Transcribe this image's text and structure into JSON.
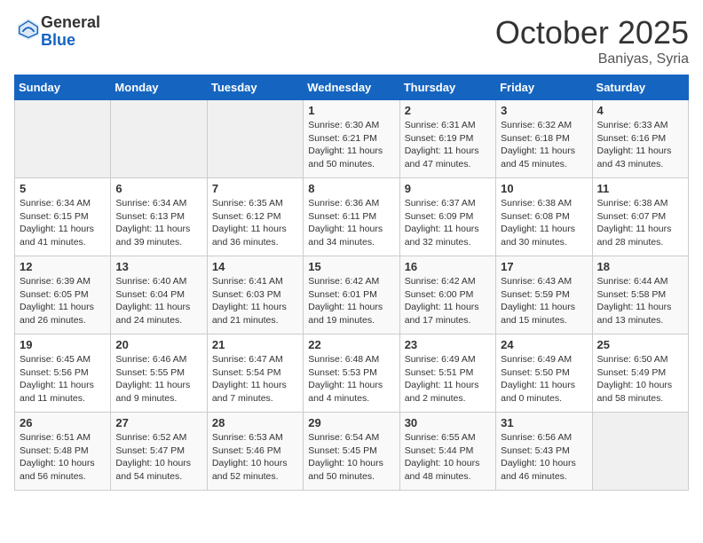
{
  "header": {
    "logo_line1": "General",
    "logo_line2": "Blue",
    "month": "October 2025",
    "location": "Baniyas, Syria"
  },
  "weekdays": [
    "Sunday",
    "Monday",
    "Tuesday",
    "Wednesday",
    "Thursday",
    "Friday",
    "Saturday"
  ],
  "weeks": [
    [
      {
        "day": "",
        "info": ""
      },
      {
        "day": "",
        "info": ""
      },
      {
        "day": "",
        "info": ""
      },
      {
        "day": "1",
        "info": "Sunrise: 6:30 AM\nSunset: 6:21 PM\nDaylight: 11 hours\nand 50 minutes."
      },
      {
        "day": "2",
        "info": "Sunrise: 6:31 AM\nSunset: 6:19 PM\nDaylight: 11 hours\nand 47 minutes."
      },
      {
        "day": "3",
        "info": "Sunrise: 6:32 AM\nSunset: 6:18 PM\nDaylight: 11 hours\nand 45 minutes."
      },
      {
        "day": "4",
        "info": "Sunrise: 6:33 AM\nSunset: 6:16 PM\nDaylight: 11 hours\nand 43 minutes."
      }
    ],
    [
      {
        "day": "5",
        "info": "Sunrise: 6:34 AM\nSunset: 6:15 PM\nDaylight: 11 hours\nand 41 minutes."
      },
      {
        "day": "6",
        "info": "Sunrise: 6:34 AM\nSunset: 6:13 PM\nDaylight: 11 hours\nand 39 minutes."
      },
      {
        "day": "7",
        "info": "Sunrise: 6:35 AM\nSunset: 6:12 PM\nDaylight: 11 hours\nand 36 minutes."
      },
      {
        "day": "8",
        "info": "Sunrise: 6:36 AM\nSunset: 6:11 PM\nDaylight: 11 hours\nand 34 minutes."
      },
      {
        "day": "9",
        "info": "Sunrise: 6:37 AM\nSunset: 6:09 PM\nDaylight: 11 hours\nand 32 minutes."
      },
      {
        "day": "10",
        "info": "Sunrise: 6:38 AM\nSunset: 6:08 PM\nDaylight: 11 hours\nand 30 minutes."
      },
      {
        "day": "11",
        "info": "Sunrise: 6:38 AM\nSunset: 6:07 PM\nDaylight: 11 hours\nand 28 minutes."
      }
    ],
    [
      {
        "day": "12",
        "info": "Sunrise: 6:39 AM\nSunset: 6:05 PM\nDaylight: 11 hours\nand 26 minutes."
      },
      {
        "day": "13",
        "info": "Sunrise: 6:40 AM\nSunset: 6:04 PM\nDaylight: 11 hours\nand 24 minutes."
      },
      {
        "day": "14",
        "info": "Sunrise: 6:41 AM\nSunset: 6:03 PM\nDaylight: 11 hours\nand 21 minutes."
      },
      {
        "day": "15",
        "info": "Sunrise: 6:42 AM\nSunset: 6:01 PM\nDaylight: 11 hours\nand 19 minutes."
      },
      {
        "day": "16",
        "info": "Sunrise: 6:42 AM\nSunset: 6:00 PM\nDaylight: 11 hours\nand 17 minutes."
      },
      {
        "day": "17",
        "info": "Sunrise: 6:43 AM\nSunset: 5:59 PM\nDaylight: 11 hours\nand 15 minutes."
      },
      {
        "day": "18",
        "info": "Sunrise: 6:44 AM\nSunset: 5:58 PM\nDaylight: 11 hours\nand 13 minutes."
      }
    ],
    [
      {
        "day": "19",
        "info": "Sunrise: 6:45 AM\nSunset: 5:56 PM\nDaylight: 11 hours\nand 11 minutes."
      },
      {
        "day": "20",
        "info": "Sunrise: 6:46 AM\nSunset: 5:55 PM\nDaylight: 11 hours\nand 9 minutes."
      },
      {
        "day": "21",
        "info": "Sunrise: 6:47 AM\nSunset: 5:54 PM\nDaylight: 11 hours\nand 7 minutes."
      },
      {
        "day": "22",
        "info": "Sunrise: 6:48 AM\nSunset: 5:53 PM\nDaylight: 11 hours\nand 4 minutes."
      },
      {
        "day": "23",
        "info": "Sunrise: 6:49 AM\nSunset: 5:51 PM\nDaylight: 11 hours\nand 2 minutes."
      },
      {
        "day": "24",
        "info": "Sunrise: 6:49 AM\nSunset: 5:50 PM\nDaylight: 11 hours\nand 0 minutes."
      },
      {
        "day": "25",
        "info": "Sunrise: 6:50 AM\nSunset: 5:49 PM\nDaylight: 10 hours\nand 58 minutes."
      }
    ],
    [
      {
        "day": "26",
        "info": "Sunrise: 6:51 AM\nSunset: 5:48 PM\nDaylight: 10 hours\nand 56 minutes."
      },
      {
        "day": "27",
        "info": "Sunrise: 6:52 AM\nSunset: 5:47 PM\nDaylight: 10 hours\nand 54 minutes."
      },
      {
        "day": "28",
        "info": "Sunrise: 6:53 AM\nSunset: 5:46 PM\nDaylight: 10 hours\nand 52 minutes."
      },
      {
        "day": "29",
        "info": "Sunrise: 6:54 AM\nSunset: 5:45 PM\nDaylight: 10 hours\nand 50 minutes."
      },
      {
        "day": "30",
        "info": "Sunrise: 6:55 AM\nSunset: 5:44 PM\nDaylight: 10 hours\nand 48 minutes."
      },
      {
        "day": "31",
        "info": "Sunrise: 6:56 AM\nSunset: 5:43 PM\nDaylight: 10 hours\nand 46 minutes."
      },
      {
        "day": "",
        "info": ""
      }
    ]
  ]
}
